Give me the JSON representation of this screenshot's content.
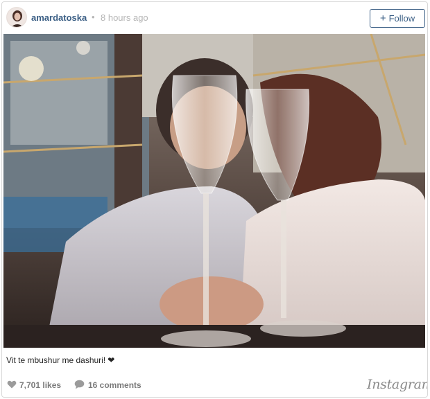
{
  "post": {
    "username": "amardatoska",
    "separator": "•",
    "time_ago": "8 hours ago",
    "follow_label": "Follow",
    "follow_icon": "plus-icon",
    "photo_description_icon": "photo",
    "caption_text": "Vit te mbushur me dashuri!",
    "caption_emoji": "❤",
    "likes": "7,701 likes",
    "comments": "16 comments",
    "brand": "Instagram"
  },
  "colors": {
    "link_blue": "#3b5f85",
    "muted_gray": "#7a7a7a",
    "time_gray": "#b5b5b5",
    "border": "#d8d8d8"
  }
}
